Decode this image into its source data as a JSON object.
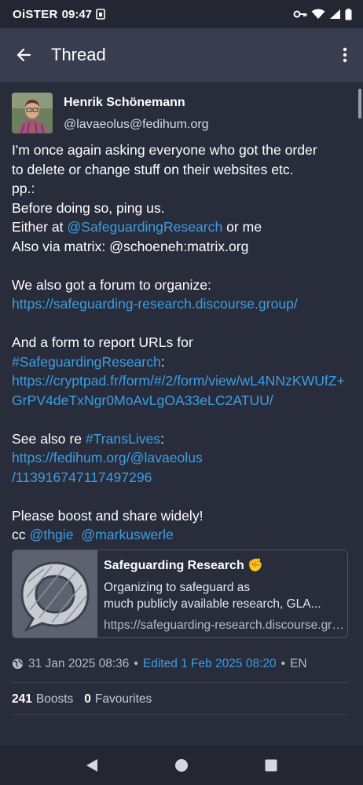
{
  "status_bar": {
    "carrier": "OiSTER",
    "time": "09:47"
  },
  "app_bar": {
    "title": "Thread"
  },
  "post": {
    "author_name": "Henrik Schönemann",
    "author_handle": "@lavaeolus@fedihum.org",
    "lines": {
      "l1": "I'm once again asking everyone who got the order",
      "l2": "to delete or change stuff on their websites etc.",
      "l3": "pp.:",
      "l4": "Before doing so, ping us.",
      "l5_prefix": "Either at ",
      "l5_mention": "@SafeguardingResearch",
      "l5_suffix": " or me",
      "l6": "Also via matrix: @schoeneh:matrix.org",
      "l7": "We also got a forum to organize:",
      "l8_link": "https://safeguarding-research.discourse.group/",
      "l9": "And a form to report URLs for",
      "l10_hashtag": "#SafeguardingResearch",
      "l10_suffix": ":",
      "l11_link": "https://cryptpad.fr/form/#/2/form/view/wL4NNzKWUfZ+GrPV4deTxNgr0MoAvLgOA33eLC2ATUU/",
      "l12_prefix": "See also re ",
      "l12_hashtag": "#TransLives",
      "l12_suffix": ":",
      "l13_link_a": "https://fedihum.org/@lavaeolus",
      "l13_link_b": "/113916747117497296",
      "l14": "Please boost and share widely!",
      "l15_prefix": "cc ",
      "l15_mention1": "@thgie",
      "l15_mention2": "@markuswerle"
    },
    "card": {
      "title": "Safeguarding Research ✊",
      "description_1": "Organizing to safeguard as",
      "description_2": "much publicly available research, GLA...",
      "url": "https://safeguarding-research.discourse.group/"
    },
    "meta": {
      "date": "31 Jan 2025 08:36",
      "separator": "•",
      "edited": "Edited 1 Feb 2025 08:20",
      "language": "EN"
    },
    "stats": {
      "boosts_count": "241",
      "boosts_label": "Boosts",
      "favourites_count": "0",
      "favourites_label": "Favourites"
    }
  },
  "colors": {
    "background": "#292c3a",
    "app_bar": "#3a3d50",
    "link": "#3a9fe6"
  },
  "icons": [
    "back-arrow-icon",
    "more-vert-icon",
    "globe-icon",
    "nav-back-icon",
    "nav-home-icon",
    "nav-recents-icon"
  ]
}
